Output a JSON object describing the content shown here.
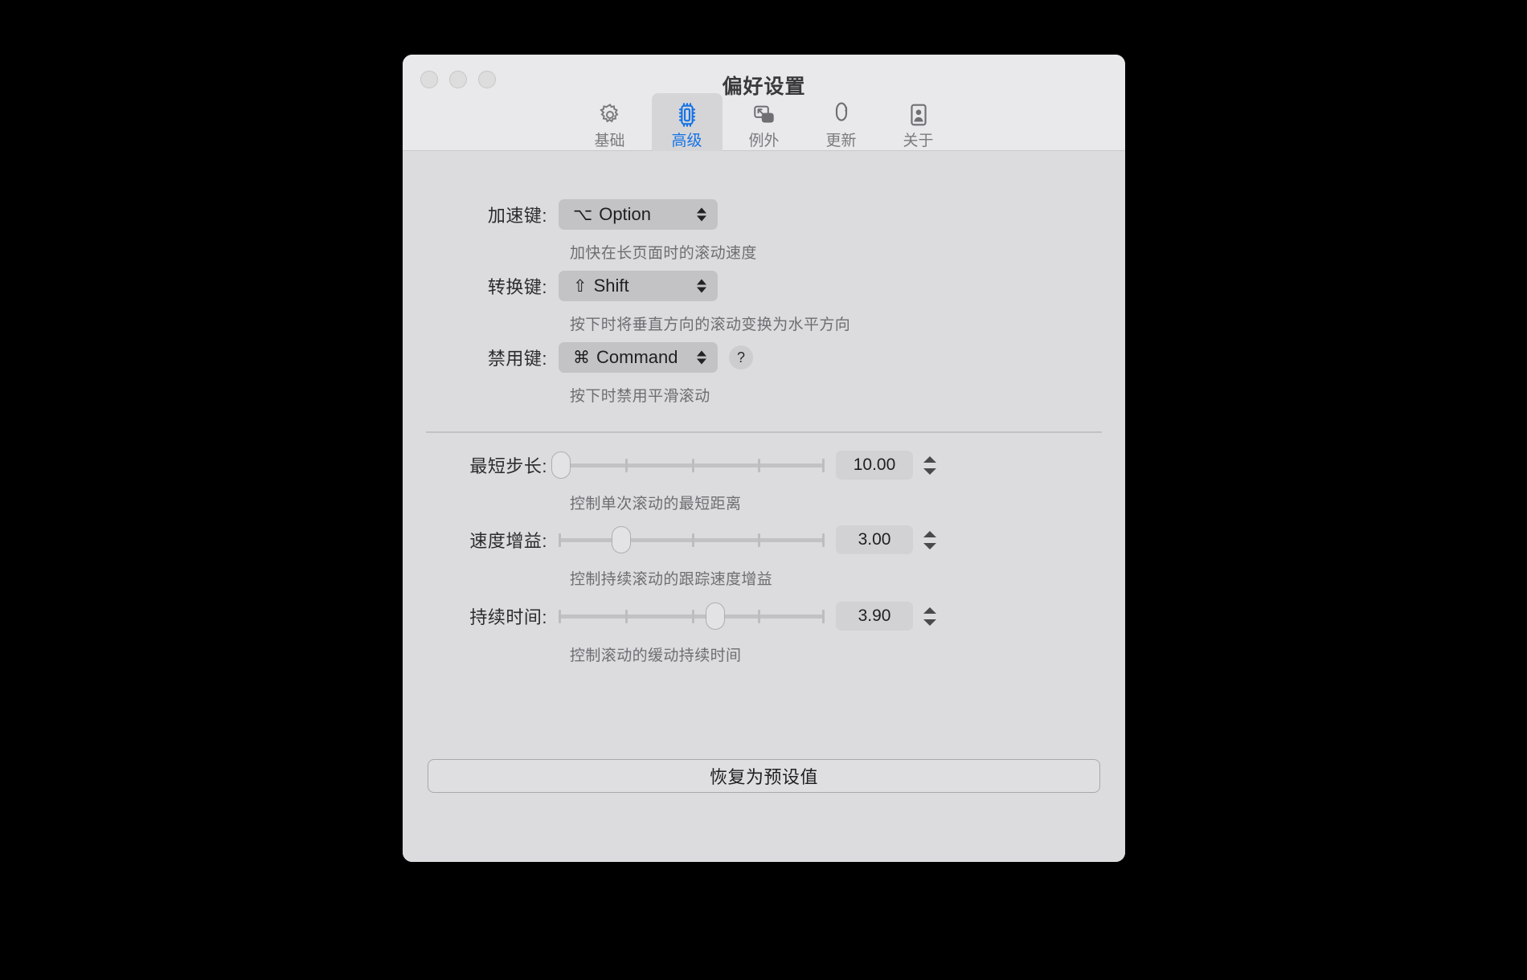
{
  "window": {
    "title": "偏好设置",
    "traffic_lights": [
      "close",
      "minimize",
      "zoom"
    ],
    "accent_color": "#1573e6",
    "background_color": "#dcdcde",
    "titlebar_color": "#e9e9eb"
  },
  "toolbar": {
    "tabs": [
      {
        "id": "basic",
        "label": "基础",
        "icon": "gear-icon",
        "selected": false
      },
      {
        "id": "advanced",
        "label": "高级",
        "icon": "chip-icon",
        "selected": true
      },
      {
        "id": "exception",
        "label": "例外",
        "icon": "windows-cursor-icon",
        "selected": false
      },
      {
        "id": "update",
        "label": "更新",
        "icon": "refresh-loop-icon",
        "selected": false
      },
      {
        "id": "about",
        "label": "关于",
        "icon": "person-card-icon",
        "selected": false
      }
    ]
  },
  "settings": {
    "popup_rows": [
      {
        "label": "加速键:",
        "key_symbol": "⌥",
        "value": "Option",
        "hint": "加快在长页面时的滚动速度",
        "has_help": false
      },
      {
        "label": "转换键:",
        "key_symbol": "⇧",
        "value": "Shift",
        "hint": "按下时将垂直方向的滚动变换为水平方向",
        "has_help": false
      },
      {
        "label": "禁用键:",
        "key_symbol": "⌘",
        "value": "Command",
        "hint": "按下时禁用平滑滚动",
        "has_help": true,
        "help_label": "?"
      }
    ],
    "slider_rows": [
      {
        "label": "最短步长:",
        "value": "10.00",
        "percent": 0,
        "ticks": [
          0,
          25,
          50,
          75,
          100
        ],
        "hint": "控制单次滚动的最短距离"
      },
      {
        "label": "速度增益:",
        "value": "3.00",
        "percent": 23.5,
        "ticks": [
          0,
          25,
          50,
          75,
          100
        ],
        "hint": "控制持续滚动的跟踪速度增益"
      },
      {
        "label": "持续时间:",
        "value": "3.90",
        "percent": 70,
        "ticks": [
          0,
          25,
          50,
          75,
          100
        ],
        "hint": "控制滚动的缓动持续时间"
      }
    ],
    "reset_button_label": "恢复为预设值"
  }
}
